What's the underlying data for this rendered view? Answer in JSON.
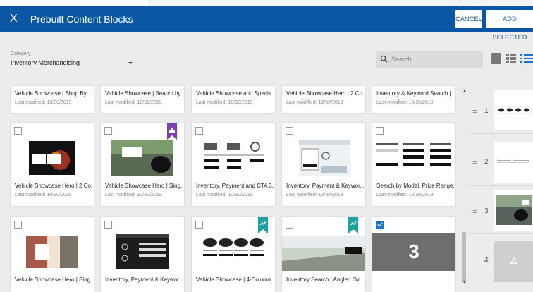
{
  "header": {
    "title": "Prebuilt Content Blocks",
    "close_glyph": "X",
    "cancel_label": "CANCEL",
    "add_label": "ADD SELECTED",
    "color": "#0b57a4"
  },
  "filters": {
    "category_label": "Category",
    "category_value": "Inventory Merchandising",
    "search_placeholder": "Search"
  },
  "view_modes": [
    "large-view-icon",
    "grid-view-icon",
    "list-view-icon"
  ],
  "cards_top": [
    {
      "name": "Vehicle Showcase | Shop By ...",
      "date": "Last modified: 10/30/2019"
    },
    {
      "name": "Vehicle Showcase | Search by...",
      "date": "Last modified: 10/30/2019"
    },
    {
      "name": "Vehicle Showcase and Specia...",
      "date": "Last modified: 10/30/2019"
    },
    {
      "name": "Vehicle Showcase Hero | 2 Co...",
      "date": "Last modified: 10/30/2019"
    },
    {
      "name": "Inventory & Keyword Search | ...",
      "date": "Last modified: 10/30/2019"
    }
  ],
  "cards_mid": [
    {
      "name": "Vehicle Showcase Hero | 2 Co...",
      "date": "Last modified: 10/30/2019"
    },
    {
      "name": "Vehicle Showcase Hero | Sing...",
      "date": "Last modified: 10/30/2019"
    },
    {
      "name": "Inventory, Payment and CTA 3...",
      "date": "Last modified: 10/30/2019"
    },
    {
      "name": "Inventory, Payment & Keywor...",
      "date": "Last modified: 10/30/2019"
    },
    {
      "name": "Search by Model, Price Range...",
      "date": "Last modified: 10/30/2019"
    }
  ],
  "cards_bottom": [
    {
      "name": "Vehicle Showcase Hero | Sing..."
    },
    {
      "name": "Inventory, Payment & Keywor..."
    },
    {
      "name": "Vehicle Showcase | 4-Column"
    },
    {
      "name": "Inventory Search | Angled Ov..."
    },
    {
      "name": "",
      "overlay": "3"
    }
  ],
  "selected": {
    "drag_glyph": "=",
    "rows": [
      {
        "num": "1"
      },
      {
        "num": "2"
      },
      {
        "num": "3"
      },
      {
        "num": "4",
        "placeholder": "4"
      }
    ]
  },
  "colors": {
    "accent": "#1a73d1",
    "ribbon_purple": "#7b3fb8",
    "ribbon_teal": "#1aa39a"
  }
}
